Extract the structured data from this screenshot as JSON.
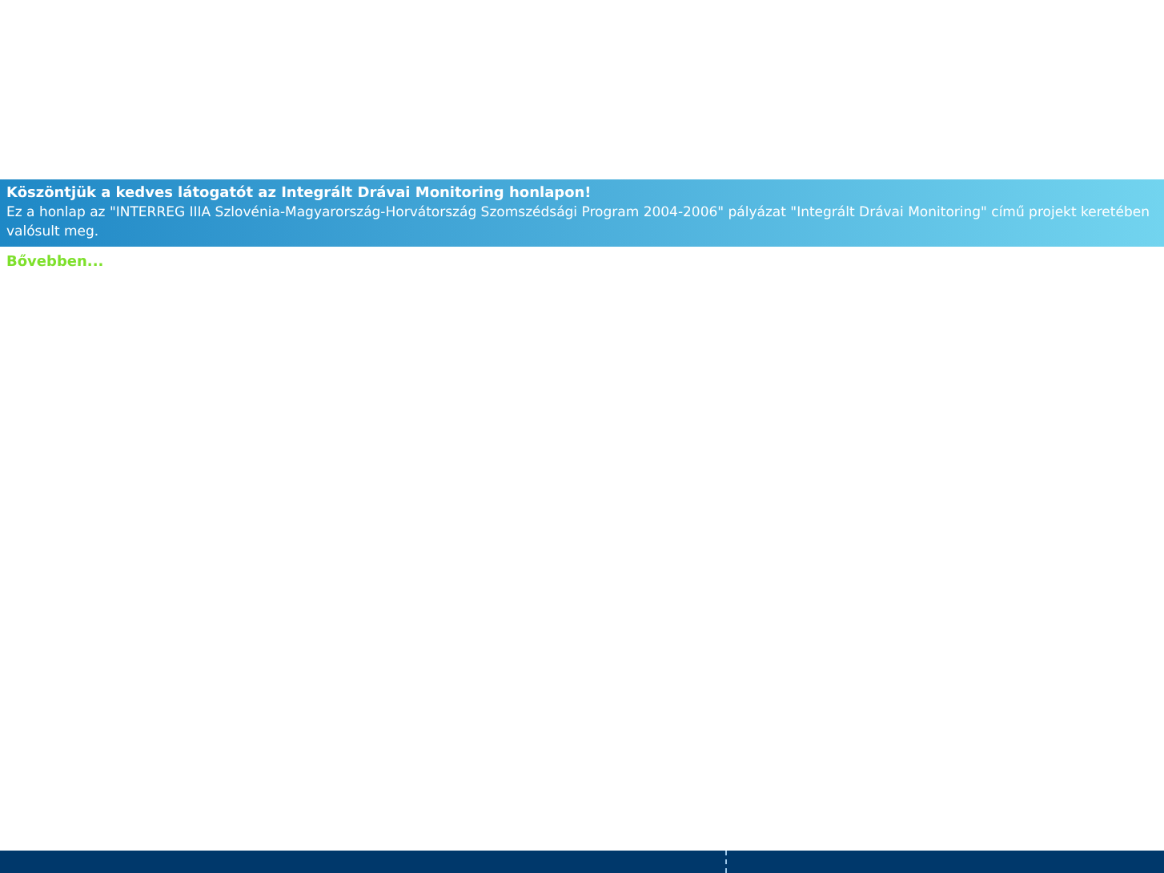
{
  "banner": {
    "title": "Köszöntjük a kedves látogatót az Integrált Drávai Monitoring honlapon!",
    "text": "Ez a honlap az \"INTERREG IIIA Szlovénia-Magyarország-Horvátország Szomszédsági Program 2004-2006\" pályázat \"Integrált Drávai Monitoring\" című projekt keretében valósult meg.",
    "more_link": "Bővebben..."
  }
}
